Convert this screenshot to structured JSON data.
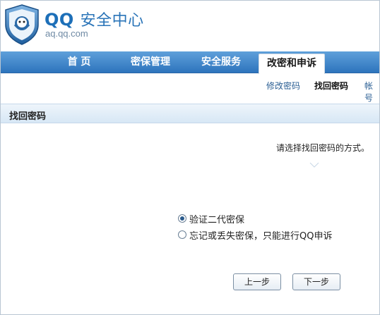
{
  "brand": {
    "title_latin": "QQ",
    "title_cn": "安全中心",
    "url": "aq.qq.com"
  },
  "nav": {
    "items": [
      {
        "label": "首 页",
        "active": false
      },
      {
        "label": "密保管理",
        "active": false
      },
      {
        "label": "安全服务",
        "active": false
      },
      {
        "label": "改密和申诉",
        "active": true
      }
    ]
  },
  "subnav": {
    "items": [
      {
        "label": "修改密码",
        "current": false
      },
      {
        "label": "找回密码",
        "current": true
      },
      {
        "label": "帐号",
        "current": false
      }
    ]
  },
  "section": {
    "title": "找回密码",
    "hint": "请选择找回密码的方式。"
  },
  "options": [
    {
      "label": "验证二代密保",
      "checked": true
    },
    {
      "label": "忘记或丢失密保，只能进行QQ申诉",
      "checked": false
    }
  ],
  "buttons": {
    "prev": "上一步",
    "next": "下一步"
  },
  "colors": {
    "nav_top": "#5fa0da",
    "nav_bottom": "#2d74bd",
    "brand_blue": "#1d6fb8",
    "link_blue": "#2b5f94"
  }
}
